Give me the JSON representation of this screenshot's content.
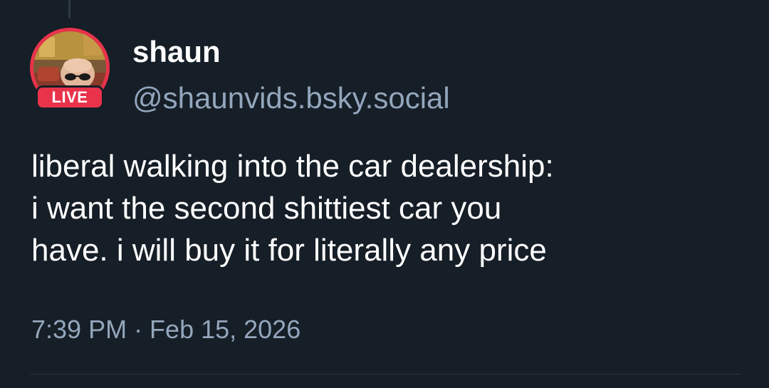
{
  "post": {
    "author": {
      "display_name": "shaun",
      "handle": "@shaunvids.bsky.social",
      "live_badge": "LIVE"
    },
    "text": "liberal walking into the car dealership:\ni want the second shittiest car you\nhave. i will buy it for literally any price",
    "timestamp": "7:39 PM · Feb 15, 2026"
  },
  "colors": {
    "background": "#161e27",
    "text_primary": "#ffffff",
    "text_secondary": "#93a6bc",
    "live_accent": "#e8334b"
  },
  "icons": {
    "avatar": "user-avatar-image"
  }
}
